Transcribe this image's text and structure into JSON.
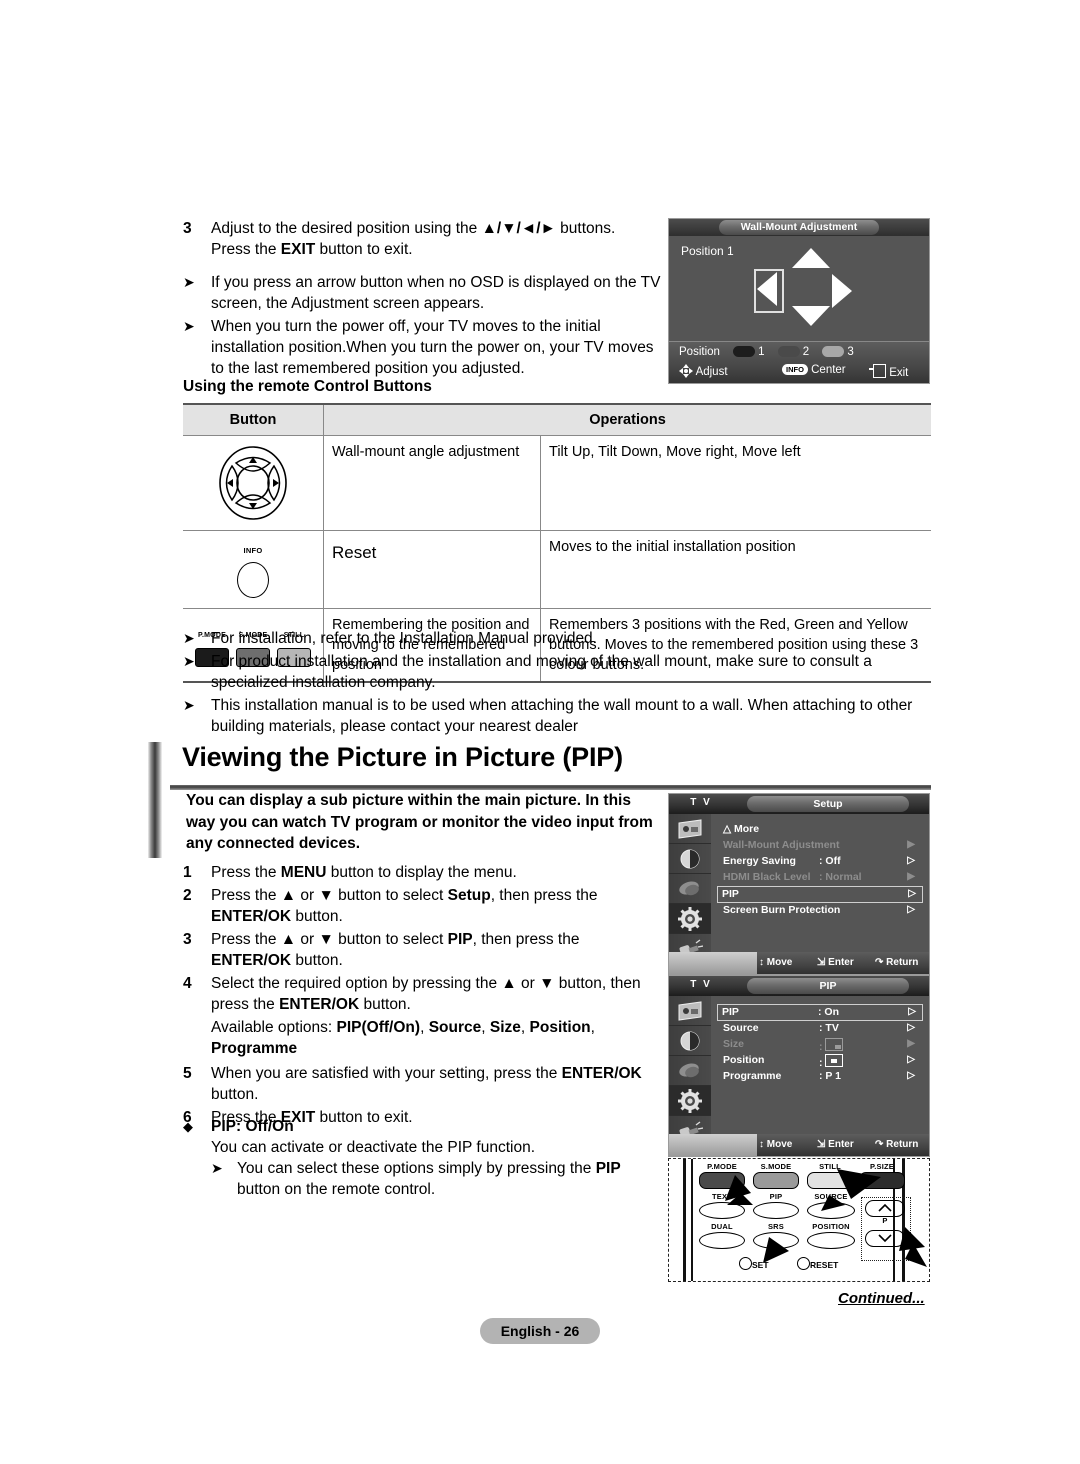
{
  "top_steps": [
    {
      "num": "3",
      "text": "Adjust to the desired position using the ▲/▼/◄/► buttons. Press the EXIT button to exit."
    }
  ],
  "top_notes": [
    "If you press an arrow button when no OSD is displayed on the TV screen, the Adjustment screen appears.",
    "When you turn the power off, your TV moves to the initial installation position.When you turn the power on, your TV moves to the last remembered position you adjusted."
  ],
  "wall_mount_osd": {
    "title": "Wall-Mount Adjustment",
    "position_label": "Position 1",
    "footer_position_label": "Position",
    "positions": [
      "1",
      "2",
      "3"
    ],
    "hint_adjust": "Adjust",
    "hint_center": "Center",
    "hint_center_key": "INFO",
    "hint_exit": "Exit"
  },
  "table_section": {
    "subhead": "Using the remote Control Buttons",
    "headers": [
      "Button",
      "Operations"
    ],
    "rows": [
      {
        "icon": "dpad-icon",
        "name": "Wall-mount angle adjustment",
        "ops": "Tilt Up, Tilt Down, Move right, Move left"
      },
      {
        "icon": "info-button-icon",
        "name": "Reset",
        "ops": "Moves to the initial installation position"
      },
      {
        "icon": "colour-buttons-icon",
        "name": "Remembering the position and moving to the remembered position",
        "ops": "Remembers 3 positions with the Red, Green and Yellow buttons. Moves to the remembered position using these 3 colour buttons."
      }
    ],
    "icon_labels": {
      "info": "INFO",
      "pmode": "P.MODE",
      "smode": "S.MODE",
      "still": "STILL"
    }
  },
  "install_notes": [
    "For installation, refer to the Installation Manual provided.",
    "For product installation and the installation and moving of the wall mount, make sure to consult a specialized installation company.",
    "This installation manual is to be used when attaching the wall mount to a wall. When attaching to other building materials, please contact your nearest dealer"
  ],
  "heading": "Viewing the Picture in Picture (PIP)",
  "intro": "You can display a sub picture within the main picture. In this way you can watch TV program or monitor the video input from any connected devices.",
  "pip_steps": [
    {
      "num": "1",
      "text": "Press the MENU button to display the menu."
    },
    {
      "num": "2",
      "text": "Press the ▲ or ▼ button to select Setup, then press the ENTER/OK button."
    },
    {
      "num": "3",
      "text": "Press the ▲ or ▼ button to select PIP, then press the ENTER/OK button."
    },
    {
      "num": "4",
      "text": "Select the required option by pressing the ▲ or ▼ button, then press the ENTER/OK button."
    },
    {
      "num": "5",
      "text": "When you are satisfied with your setting, press the ENTER/OK button."
    },
    {
      "num": "6",
      "text": "Press the EXIT button to exit."
    }
  ],
  "pip_step4_sub": "Available options: PIP(Off/On), Source, Size, Position, Programme",
  "pip_offon": {
    "title": "PIP: Off/On",
    "desc": "You can activate or deactivate the PIP function.",
    "note": "You can select these options simply by pressing the PIP button on the remote control."
  },
  "setup_osd": {
    "tv_label": "T V",
    "title": "Setup",
    "items": [
      {
        "label": "△ More",
        "value": "",
        "arrow": "",
        "dim": false,
        "selected": false
      },
      {
        "label": "Wall-Mount Adjustment",
        "value": "",
        "arrow": "▶",
        "dim": true,
        "selected": false
      },
      {
        "label": "Energy Saving",
        "value": ": Off",
        "arrow": "▷",
        "dim": false,
        "selected": false
      },
      {
        "label": "HDMI Black Level",
        "value": ": Normal",
        "arrow": "▶",
        "dim": true,
        "selected": false
      },
      {
        "label": "PIP",
        "value": "",
        "arrow": "▷",
        "dim": false,
        "selected": true
      },
      {
        "label": "Screen Burn Protection",
        "value": "",
        "arrow": "▷",
        "dim": false,
        "selected": false
      }
    ],
    "footer": {
      "move": "Move",
      "enter": "Enter",
      "return": "Return"
    }
  },
  "pip_osd": {
    "tv_label": "T V",
    "title": "PIP",
    "items": [
      {
        "label": "PIP",
        "value": ": On",
        "arrow": "▷",
        "dim": false,
        "selected": true
      },
      {
        "label": "Source",
        "value": ": TV",
        "arrow": "▷",
        "dim": false,
        "selected": false
      },
      {
        "label": "Size",
        "value": ":",
        "arrow": "▶",
        "dim": true,
        "selected": false,
        "swatch": "size-box"
      },
      {
        "label": "Position",
        "value": ":",
        "arrow": "▷",
        "dim": false,
        "selected": false,
        "swatch": "position-box"
      },
      {
        "label": "Programme",
        "value": ": P   1",
        "arrow": "▷",
        "dim": false,
        "selected": false
      }
    ],
    "footer": {
      "move": "Move",
      "enter": "Enter",
      "return": "Return"
    }
  },
  "remote": {
    "keys_row1": [
      "P.MODE",
      "S.MODE",
      "STILL",
      "P.SIZE"
    ],
    "keys_row2": [
      "TEXT",
      "PIP",
      "SOURCE"
    ],
    "keys_row3": [
      "DUAL",
      "SRS",
      "POSITION"
    ],
    "channel_label": "P",
    "bottom_keys": [
      "SET",
      "RESET"
    ]
  },
  "footer": {
    "page_label": "English - 26",
    "continued": "Continued..."
  },
  "colors": {
    "table_header_bg": "#e3e3e3",
    "osd_bg": "#555555",
    "pill_bg": "#b3b3b3",
    "pos1": "#1d1d1d",
    "pos2": "#4a4a4a",
    "pos3": "#a8a8a8"
  }
}
